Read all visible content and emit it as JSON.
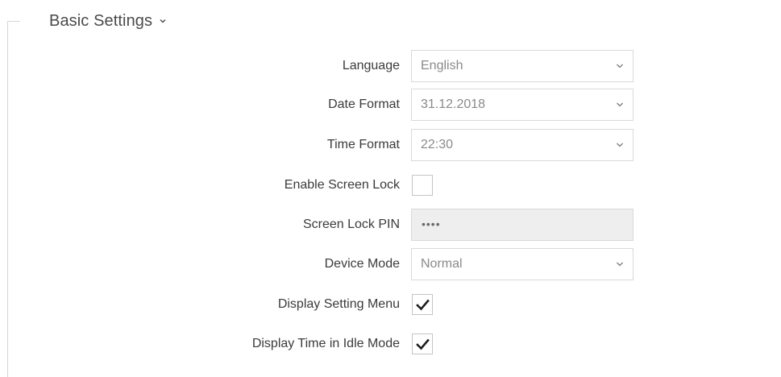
{
  "section": {
    "title": "Basic Settings",
    "chevron_icon": "chevron-down-icon"
  },
  "fields": {
    "language": {
      "label": "Language",
      "value": "English"
    },
    "date_format": {
      "label": "Date Format",
      "value": "31.12.2018"
    },
    "time_format": {
      "label": "Time Format",
      "value": "22:30"
    },
    "enable_screen_lock": {
      "label": "Enable Screen Lock",
      "checked": false
    },
    "screen_lock_pin": {
      "label": "Screen Lock PIN",
      "value": "••••"
    },
    "device_mode": {
      "label": "Device Mode",
      "value": "Normal"
    },
    "display_setting_menu": {
      "label": "Display Setting Menu",
      "checked": true
    },
    "display_time_idle": {
      "label": "Display Time in Idle Mode",
      "checked": true
    }
  },
  "colors": {
    "border": "#d9d9d9",
    "disabled_bg": "#eeeeee",
    "text": "#3b3b3b",
    "value_text": "#8a8a8a"
  }
}
